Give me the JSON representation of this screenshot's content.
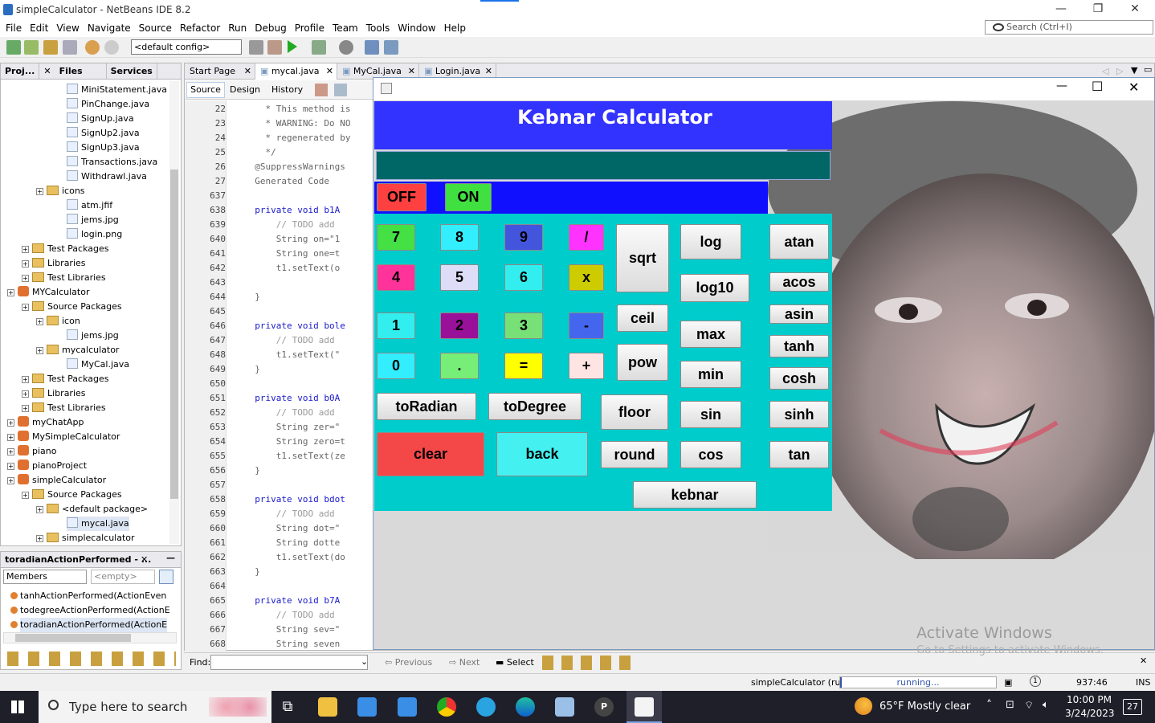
{
  "window": {
    "title": "simpleCalculator - NetBeans IDE 8.2",
    "minimize": "—",
    "maximize": "❐",
    "close": "✕"
  },
  "menu": [
    "File",
    "Edit",
    "View",
    "Navigate",
    "Source",
    "Refactor",
    "Run",
    "Debug",
    "Profile",
    "Team",
    "Tools",
    "Window",
    "Help"
  ],
  "search": {
    "placeholder": "Search (Ctrl+I)"
  },
  "toolbar": {
    "config": "<default config>"
  },
  "left_tabs": [
    "Proj...",
    "Files",
    "Services"
  ],
  "tree": [
    {
      "label": "MiniStatement.java",
      "type": "file",
      "indent": 82
    },
    {
      "label": "PinChange.java",
      "type": "file",
      "indent": 82
    },
    {
      "label": "SignUp.java",
      "type": "file",
      "indent": 82
    },
    {
      "label": "SignUp2.java",
      "type": "file",
      "indent": 82
    },
    {
      "label": "SignUp3.java",
      "type": "file",
      "indent": 82
    },
    {
      "label": "Transactions.java",
      "type": "file",
      "indent": 82
    },
    {
      "label": "Withdrawl.java",
      "type": "file",
      "indent": 82
    },
    {
      "label": "icons",
      "type": "folder",
      "indent": 44
    },
    {
      "label": "atm.jfif",
      "type": "file",
      "indent": 82
    },
    {
      "label": "jems.jpg",
      "type": "file",
      "indent": 82
    },
    {
      "label": "login.png",
      "type": "file",
      "indent": 82
    },
    {
      "label": "Test Packages",
      "type": "folder",
      "indent": 26
    },
    {
      "label": "Libraries",
      "type": "folder",
      "indent": 26
    },
    {
      "label": "Test Libraries",
      "type": "folder",
      "indent": 26
    },
    {
      "label": "MYCalculator",
      "type": "project",
      "indent": 8
    },
    {
      "label": "Source Packages",
      "type": "folder",
      "indent": 26
    },
    {
      "label": "icon",
      "type": "folder",
      "indent": 44
    },
    {
      "label": "jems.jpg",
      "type": "file",
      "indent": 82
    },
    {
      "label": "mycalculator",
      "type": "folder",
      "indent": 44
    },
    {
      "label": "MyCal.java",
      "type": "file",
      "indent": 82
    },
    {
      "label": "Test Packages",
      "type": "folder",
      "indent": 26
    },
    {
      "label": "Libraries",
      "type": "folder",
      "indent": 26
    },
    {
      "label": "Test Libraries",
      "type": "folder",
      "indent": 26
    },
    {
      "label": "myChatApp",
      "type": "project",
      "indent": 8
    },
    {
      "label": "MySimpleCalculator",
      "type": "project",
      "indent": 8
    },
    {
      "label": "piano",
      "type": "project",
      "indent": 8
    },
    {
      "label": "pianoProject",
      "type": "project",
      "indent": 8
    },
    {
      "label": "simpleCalculator",
      "type": "project",
      "indent": 8
    },
    {
      "label": "Source Packages",
      "type": "folder",
      "indent": 26
    },
    {
      "label": "<default package>",
      "type": "folder",
      "indent": 44
    },
    {
      "label": "mycal.java",
      "type": "file",
      "indent": 82
    },
    {
      "label": "simplecalculator",
      "type": "folder",
      "indent": 44
    }
  ],
  "navigator": {
    "title": "toradianActionPerformed - ...",
    "members_label": "Members",
    "empty_label": "<empty>",
    "items": [
      "tanhActionPerformed(ActionEven",
      "todegreeActionPerformed(ActionE",
      "toradianActionPerformed(ActionE"
    ]
  },
  "editor_tabs": [
    "Start Page",
    "mycal.java",
    "MyCal.java",
    "Login.java"
  ],
  "editor_views": [
    "Source",
    "Design",
    "History"
  ],
  "code_lines": [
    {
      "n": "22",
      "t": "    * This method is"
    },
    {
      "n": "23",
      "t": "    * WARNING: Do NO"
    },
    {
      "n": "24",
      "t": "    * regenerated by"
    },
    {
      "n": "25",
      "t": "    */"
    },
    {
      "n": "26",
      "t": "  @SuppressWarnings"
    },
    {
      "n": "27",
      "t": "  Generated Code"
    },
    {
      "n": "637",
      "t": ""
    },
    {
      "n": "638",
      "t": "  private void b1A"
    },
    {
      "n": "639",
      "t": "      // TODO add"
    },
    {
      "n": "640",
      "t": "      String on=\"1"
    },
    {
      "n": "641",
      "t": "      String one=t"
    },
    {
      "n": "642",
      "t": "      t1.setText(o"
    },
    {
      "n": "643",
      "t": ""
    },
    {
      "n": "644",
      "t": "  }"
    },
    {
      "n": "645",
      "t": ""
    },
    {
      "n": "646",
      "t": "  private void bole"
    },
    {
      "n": "647",
      "t": "      // TODO add"
    },
    {
      "n": "648",
      "t": "      t1.setText(\""
    },
    {
      "n": "649",
      "t": "  }"
    },
    {
      "n": "650",
      "t": ""
    },
    {
      "n": "651",
      "t": "  private void b0A"
    },
    {
      "n": "652",
      "t": "      // TODO add"
    },
    {
      "n": "653",
      "t": "      String zer=\""
    },
    {
      "n": "654",
      "t": "      String zero=t"
    },
    {
      "n": "655",
      "t": "      t1.setText(ze"
    },
    {
      "n": "656",
      "t": "  }"
    },
    {
      "n": "657",
      "t": ""
    },
    {
      "n": "658",
      "t": "  private void bdot"
    },
    {
      "n": "659",
      "t": "      // TODO add"
    },
    {
      "n": "660",
      "t": "      String dot=\""
    },
    {
      "n": "661",
      "t": "      String dotte"
    },
    {
      "n": "662",
      "t": "      t1.setText(do"
    },
    {
      "n": "663",
      "t": "  }"
    },
    {
      "n": "664",
      "t": ""
    },
    {
      "n": "665",
      "t": "  private void b7A"
    },
    {
      "n": "666",
      "t": "      // TODO add"
    },
    {
      "n": "667",
      "t": "      String sev=\""
    },
    {
      "n": "668",
      "t": "      String seven"
    }
  ],
  "find": {
    "label": "Find:",
    "previous": "Previous",
    "next": "Next",
    "select": "Select"
  },
  "status": {
    "run": "simpleCalculator (run)",
    "running": "running...",
    "position": "937:46",
    "mode": "INS"
  },
  "calc": {
    "heading": "Kebnar Calculator",
    "display": "",
    "buttons": {
      "off": "OFF",
      "on": "ON",
      "b7": "7",
      "b8": "8",
      "b9": "9",
      "div": "/",
      "b4": "4",
      "b5": "5",
      "b6": "6",
      "mul": "x",
      "b1": "1",
      "b2": "2",
      "b3": "3",
      "sub": "-",
      "b0": "0",
      "dot": ".",
      "eq": "=",
      "add": "+",
      "sqrt": "sqrt",
      "ceil": "ceil",
      "pow": "pow",
      "log": "log",
      "log10": "log10",
      "max": "max",
      "min": "min",
      "sin": "sin",
      "cos": "cos",
      "atan": "atan",
      "acos": "acos",
      "asin": "asin",
      "tanh": "tanh",
      "cosh": "cosh",
      "sinh": "sinh",
      "tan": "tan",
      "toradian": "toRadian",
      "todegree": "toDegree",
      "floor": "floor",
      "round": "round",
      "clear": "clear",
      "back": "back",
      "kebnar": "kebnar"
    }
  },
  "watermark": {
    "title": "Activate Windows",
    "sub": "Go to Settings to activate Windows."
  },
  "taskbar": {
    "search": "Type here to search",
    "weather": "65°F  Mostly clear",
    "time": "10:00 PM",
    "date": "3/24/2023",
    "notif": "27"
  },
  "colors": {
    "cyan": "#00cccc",
    "blue": "#3333ff",
    "display": "#006666"
  }
}
